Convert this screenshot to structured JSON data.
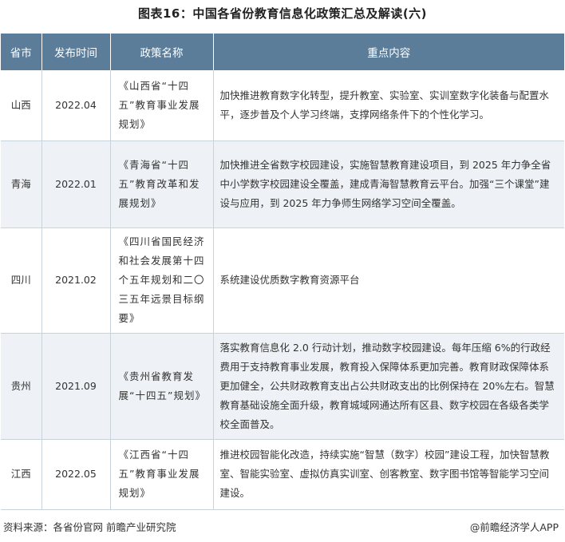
{
  "title": "图表16：中国各省份教育信息化政策汇总及解读(六)",
  "table": {
    "headers": [
      "省市",
      "发布时间",
      "政策名称",
      "重点内容"
    ],
    "rows": [
      {
        "province": "山西",
        "date": "2022.04",
        "policy": "《山西省“十四五”教育事业发展规划》",
        "points": "加快推进教育数字化转型，提升教室、实验室、实训室数字化装备与配置水平，逐步普及个人学习终端，支撑网络条件下的个性化学习。"
      },
      {
        "province": "青海",
        "date": "2022.01",
        "policy": "《青海省“十四五”教育改革和发展规划》",
        "points": "加快推进全省数字校园建设，实施智慧教育建设项目，到 2025 年力争全省中小学数字校园建设全覆盖，建成青海智慧教育云平台。加强“三个课堂”建设与应用，到 2025 年力争师生网络学习空间全覆盖。"
      },
      {
        "province": "四川",
        "date": "2021.02",
        "policy": "《四川省国民经济和社会发展第十四个五年规划和二〇三五年远景目标纲要》",
        "points": "系统建设优质数字教育资源平台"
      },
      {
        "province": "贵州",
        "date": "2021.09",
        "policy": "《贵州省教育发展“十四五”规划》",
        "points": "落实教育信息化 2.0 行动计划，推动数字校园建设。每年压缩 6%的行政经费用于支持教育事业发展，教育投入保障体系更加完善。教育财政保障体系更加健全，公共财政教育支出占公共财政支出的比例保持在 20%左右。智慧教育基础设施全面升级，教育城域网通达所有区县、数字校园在各级各类学校全面普及。"
      },
      {
        "province": "江西",
        "date": "2022.05",
        "policy": "《江西省“十四五”教育事业发展规划》",
        "points": "推进校园智能化改造，持续实施“智慧（数字）校园”建设工程，加快智慧教室、智能实验室、虚拟仿真实训室、创客教室、数字图书馆等智能学习空间建设。"
      }
    ]
  },
  "footer": {
    "source": "资料来源：各省份官网 前瞻产业研究院",
    "brand": "@前瞻经济学人APP"
  },
  "colors": {
    "header_bg": "#5b7d9a",
    "row_alt_bg": "#eef1f5",
    "border": "#c9d3dc"
  }
}
